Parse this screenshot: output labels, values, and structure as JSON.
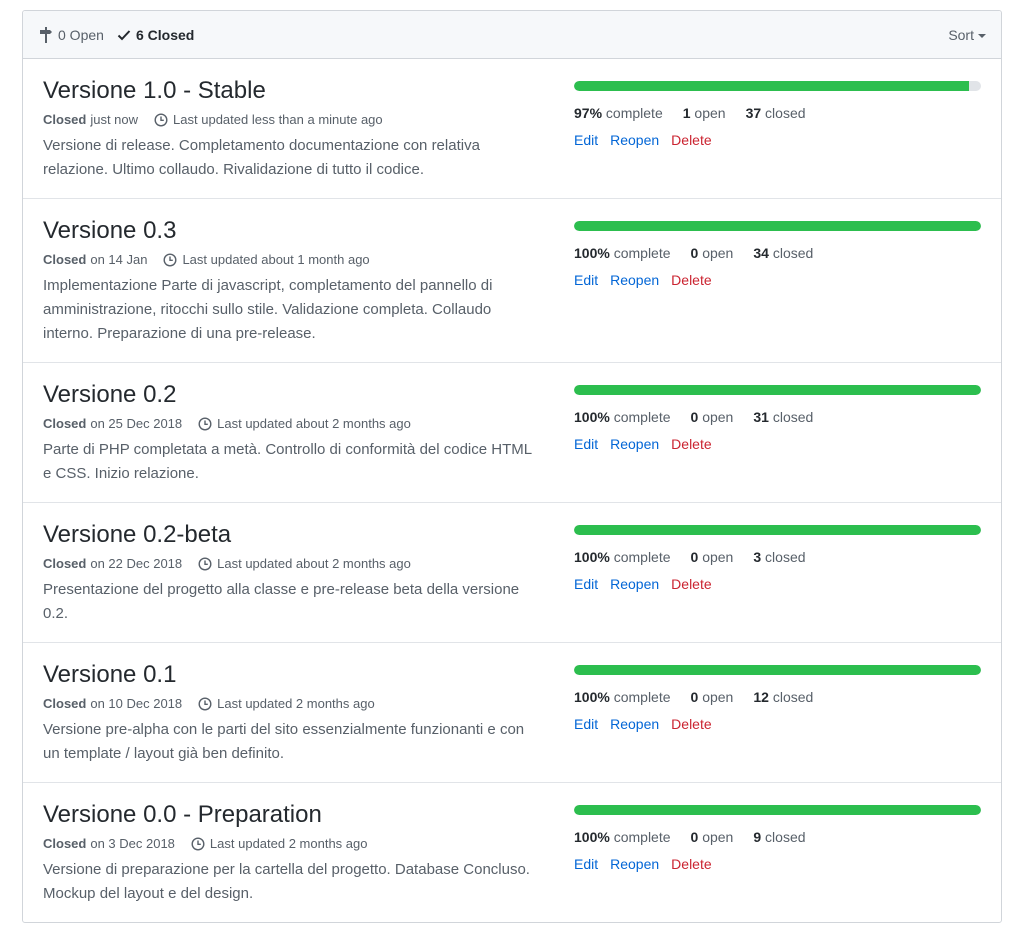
{
  "header": {
    "open_count_label": "0 Open",
    "closed_count_label": "6 Closed",
    "sort_label": "Sort"
  },
  "colors": {
    "progress_fill": "#2cbe4e",
    "link": "#0366d6",
    "delete": "#cb2431"
  },
  "milestones": [
    {
      "title": "Versione 1.0 - Stable",
      "closed_word": "Closed",
      "closed_date": "just now",
      "updated": "Last updated less than a minute ago",
      "description": "Versione di release. Completamento documentazione con relativa relazione. Ultimo collaudo. Rivalidazione di tutto il codice.",
      "progress_fraction": 0.97,
      "percent": "97%",
      "complete_word": "complete",
      "open_count": "1",
      "open_word": "open",
      "closed_count": "37",
      "closed_word_stat": "closed",
      "edit": "Edit",
      "reopen": "Reopen",
      "delete": "Delete"
    },
    {
      "title": "Versione 0.3",
      "closed_word": "Closed",
      "closed_date": "on 14 Jan",
      "updated": "Last updated about 1 month ago",
      "description": "Implementazione Parte di javascript, completamento del pannello di amministrazione, ritocchi sullo stile. Validazione completa. Collaudo interno. Preparazione di una pre-release.",
      "progress_fraction": 1.0,
      "percent": "100%",
      "complete_word": "complete",
      "open_count": "0",
      "open_word": "open",
      "closed_count": "34",
      "closed_word_stat": "closed",
      "edit": "Edit",
      "reopen": "Reopen",
      "delete": "Delete"
    },
    {
      "title": "Versione 0.2",
      "closed_word": "Closed",
      "closed_date": "on 25 Dec 2018",
      "updated": "Last updated about 2 months ago",
      "description": "Parte di PHP completata a metà. Controllo di conformità del codice HTML e CSS. Inizio relazione.",
      "progress_fraction": 1.0,
      "percent": "100%",
      "complete_word": "complete",
      "open_count": "0",
      "open_word": "open",
      "closed_count": "31",
      "closed_word_stat": "closed",
      "edit": "Edit",
      "reopen": "Reopen",
      "delete": "Delete"
    },
    {
      "title": "Versione 0.2-beta",
      "closed_word": "Closed",
      "closed_date": "on 22 Dec 2018",
      "updated": "Last updated about 2 months ago",
      "description": "Presentazione del progetto alla classe e pre-release beta della versione 0.2.",
      "progress_fraction": 1.0,
      "percent": "100%",
      "complete_word": "complete",
      "open_count": "0",
      "open_word": "open",
      "closed_count": "3",
      "closed_word_stat": "closed",
      "edit": "Edit",
      "reopen": "Reopen",
      "delete": "Delete"
    },
    {
      "title": "Versione 0.1",
      "closed_word": "Closed",
      "closed_date": "on 10 Dec 2018",
      "updated": "Last updated 2 months ago",
      "description": "Versione pre-alpha con le parti del sito essenzialmente funzionanti e con un template / layout già ben definito.",
      "progress_fraction": 1.0,
      "percent": "100%",
      "complete_word": "complete",
      "open_count": "0",
      "open_word": "open",
      "closed_count": "12",
      "closed_word_stat": "closed",
      "edit": "Edit",
      "reopen": "Reopen",
      "delete": "Delete"
    },
    {
      "title": "Versione 0.0 - Preparation",
      "closed_word": "Closed",
      "closed_date": "on 3 Dec 2018",
      "updated": "Last updated 2 months ago",
      "description": "Versione di preparazione per la cartella del progetto. Database Concluso. Mockup del layout e del design.",
      "progress_fraction": 1.0,
      "percent": "100%",
      "complete_word": "complete",
      "open_count": "0",
      "open_word": "open",
      "closed_count": "9",
      "closed_word_stat": "closed",
      "edit": "Edit",
      "reopen": "Reopen",
      "delete": "Delete"
    }
  ]
}
